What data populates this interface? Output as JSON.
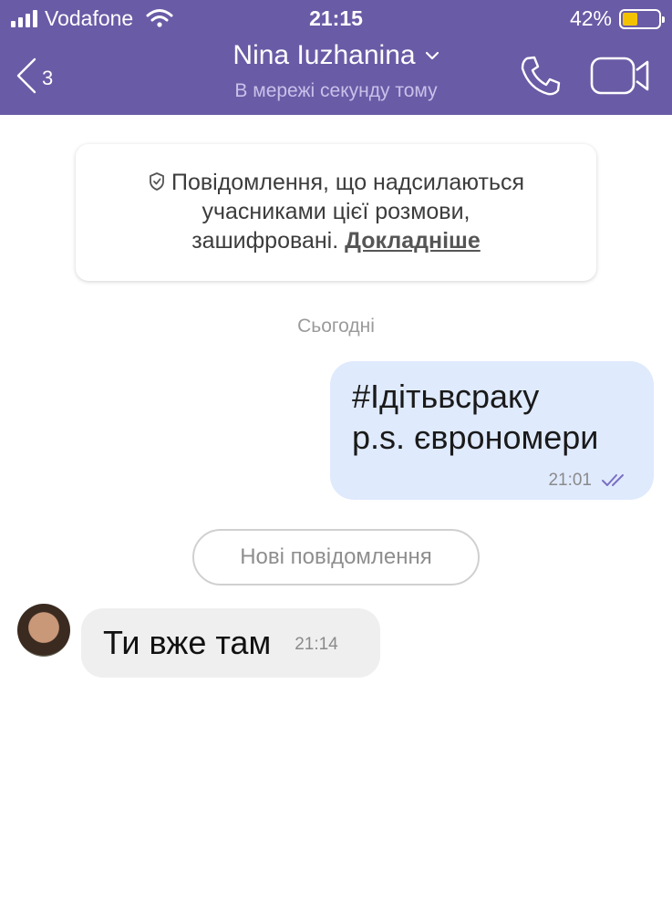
{
  "status_bar": {
    "carrier": "Vodafone",
    "time": "21:15",
    "battery_percent": "42%",
    "battery_level": 0.42,
    "battery_color": "#f2c200"
  },
  "header": {
    "back_count": "3",
    "contact_name": "Nina Iuzhanina",
    "presence": "В мережі секунду тому",
    "icons": [
      "chevron-left-icon",
      "chevron-down-icon",
      "phone-icon",
      "video-camera-icon"
    ],
    "background_color": "#6a5ba6"
  },
  "encryption_notice": {
    "text": "Повідомлення, що надсилаються учасниками цієї розмови, зашифровані.",
    "line1": "Повідомлення, що надсилаються",
    "line2": "учасниками цієї розмови,",
    "line3": "зашифровані.",
    "link": "Докладніше"
  },
  "date_separator": "Сьогодні",
  "messages": [
    {
      "direction": "outgoing",
      "line1": "#Ідітьвсраку",
      "line2": "p.s. єврономери",
      "time": "21:01",
      "status_icon": "double-check-icon"
    },
    {
      "direction": "incoming",
      "text": "Ти вже там",
      "time": "21:14"
    }
  ],
  "new_messages_label": "Нові повідомлення"
}
